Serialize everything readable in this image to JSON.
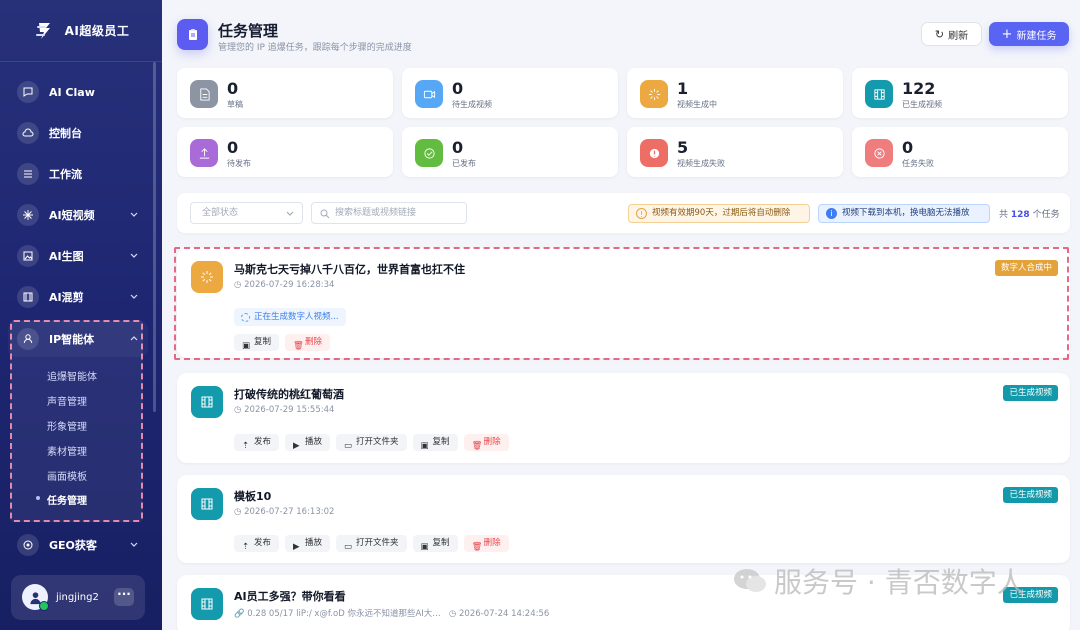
{
  "app": {
    "title": "AI超级员工"
  },
  "sidebar": {
    "items": [
      {
        "label": "AI Claw",
        "icon": "chat-bubble-icon"
      },
      {
        "label": "控制台",
        "icon": "cloud-icon"
      },
      {
        "label": "工作流",
        "icon": "workflow-icon"
      },
      {
        "label": "AI短视频",
        "icon": "video-sparkle-icon"
      },
      {
        "label": "AI生图",
        "icon": "image-icon"
      },
      {
        "label": "AI混剪",
        "icon": "film-icon"
      },
      {
        "label": "IP智能体",
        "icon": "user-icon"
      },
      {
        "label": "GEO获客",
        "icon": "target-icon"
      }
    ],
    "ip_submenu": [
      "追爆智能体",
      "声音管理",
      "形象管理",
      "素材管理",
      "画面模板",
      "任务管理"
    ],
    "user": {
      "name": "jingjing2",
      "more": "···"
    }
  },
  "header": {
    "title": "任务管理",
    "subtitle": "管理您的 IP 追爆任务，跟踪每个步骤的完成进度",
    "refresh_label": "刷新",
    "new_task_label": "新建任务"
  },
  "stats": [
    {
      "value": "0",
      "label": "草稿",
      "color": "#8d94a4",
      "icon": "document-icon"
    },
    {
      "value": "0",
      "label": "待生成视频",
      "color": "#56a8f7",
      "icon": "video-camera-icon"
    },
    {
      "value": "1",
      "label": "视频生成中",
      "color": "#eda941",
      "icon": "spinner-icon"
    },
    {
      "value": "122",
      "label": "已生成视频",
      "color": "#139aac",
      "icon": "film-icon"
    },
    {
      "value": "0",
      "label": "待发布",
      "color": "#a86bd7",
      "icon": "upload-icon"
    },
    {
      "value": "0",
      "label": "已发布",
      "color": "#62bc3f",
      "icon": "check-circle-icon"
    },
    {
      "value": "5",
      "label": "视频生成失败",
      "color": "#ed6e65",
      "icon": "alert-icon"
    },
    {
      "value": "0",
      "label": "任务失败",
      "color": "#ef7d7d",
      "icon": "x-circle-icon"
    }
  ],
  "filters": {
    "status_value": "全部状态",
    "search_placeholder": "搜索标题或视频链接",
    "notice_expiry": "视频有效期90天，过期后将自动删除",
    "notice_download": "视频下载到本机，换电脑无法播放",
    "total_prefix": "共",
    "total_count": "128",
    "total_suffix": "个任务"
  },
  "tasks": [
    {
      "title": "马斯克七天亏掉八千八百亿，世界首富也扛不住",
      "time": "2026-07-29 16:28:34",
      "status": "数字人合成中",
      "status_color": "#e3a33a",
      "progress": "正在生成数字人视频...",
      "actions": [
        "复制",
        "删除"
      ]
    },
    {
      "title": "打破传统的桃红葡萄酒",
      "time": "2026-07-29 15:55:44",
      "status": "已生成视频",
      "status_color": "#1399a9",
      "actions": [
        "发布",
        "播放",
        "打开文件夹",
        "复制",
        "删除"
      ]
    },
    {
      "title": "模板10",
      "time": "2026-07-27 16:13:02",
      "status": "已生成视频",
      "status_color": "#1399a9",
      "actions": [
        "发布",
        "播放",
        "打开文件夹",
        "复制",
        "删除"
      ]
    },
    {
      "title": "AI员工多强？带你看看",
      "link": "0.28 05/17 liP:/ x@f.oD 你永远不知道那些AI大…",
      "time": "2026-07-24 14:24:56",
      "status": "已生成视频",
      "status_color": "#1399a9"
    }
  ],
  "watermark": {
    "text": "服务号 · 青否数字人"
  }
}
